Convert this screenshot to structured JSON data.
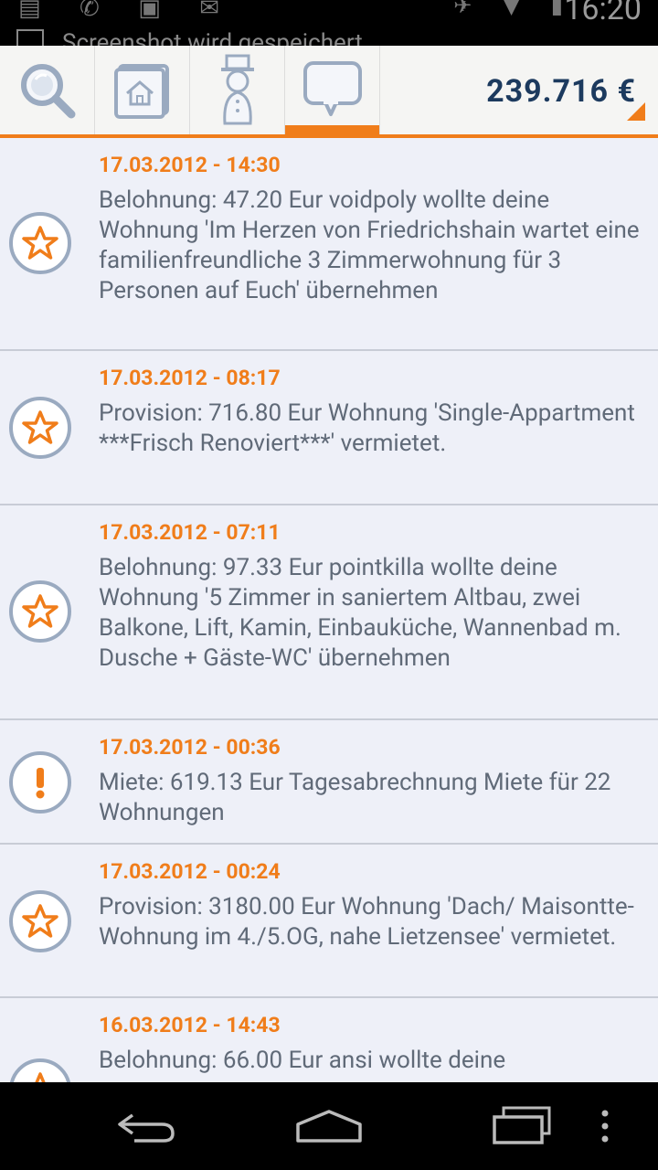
{
  "status_bar": {
    "time": "16:20",
    "notification": "Screenshot wird gespeichert"
  },
  "toolbar": {
    "tabs": [
      {
        "icon": "search-icon",
        "active": false
      },
      {
        "icon": "home-folder-icon",
        "active": false
      },
      {
        "icon": "landlord-figure-icon",
        "active": false
      },
      {
        "icon": "speech-bubble-icon",
        "active": true
      }
    ],
    "balance": "239.716 €"
  },
  "messages": [
    {
      "icon": "star-icon",
      "date": "17.03.2012 - 14:30",
      "text": "Belohnung: 47.20 Eur voidpoly wollte deine Wohnung 'Im Herzen von Friedrichshain wartet eine familienfreundliche 3 Zimmerwohnung für 3 Personen auf Euch' übernehmen"
    },
    {
      "icon": "star-icon",
      "date": "17.03.2012 - 08:17",
      "text": "Provision: 716.80 Eur Wohnung 'Single-Appartment ***Frisch Renoviert***' vermietet."
    },
    {
      "icon": "star-icon",
      "date": "17.03.2012 - 07:11",
      "text": "Belohnung: 97.33 Eur pointkilla wollte deine Wohnung '5 Zimmer in saniertem Altbau, zwei Balkone, Lift, Kamin, Einbauküche, Wannenbad m. Dusche + Gäste-WC' übernehmen"
    },
    {
      "icon": "exclamation-icon",
      "date": "17.03.2012 - 00:36",
      "text": "Miete: 619.13 Eur Tagesabrechnung Miete für 22 Wohnungen"
    },
    {
      "icon": "star-icon",
      "date": "17.03.2012 - 00:24",
      "text": "Provision: 3180.00 Eur Wohnung 'Dach/ Maisontte-Wohnung im 4./5.OG, nahe Lietzensee' vermietet."
    },
    {
      "icon": "star-icon",
      "date": "16.03.2012 - 14:43",
      "text": "Belohnung: 66.00 Eur ansi wollte deine"
    }
  ],
  "colors": {
    "accent": "#f07d1a",
    "balance_text": "#1c3a5e",
    "list_bg": "#eef0f8",
    "body_text": "#606a78",
    "icon_ring": "#9aaac0"
  }
}
